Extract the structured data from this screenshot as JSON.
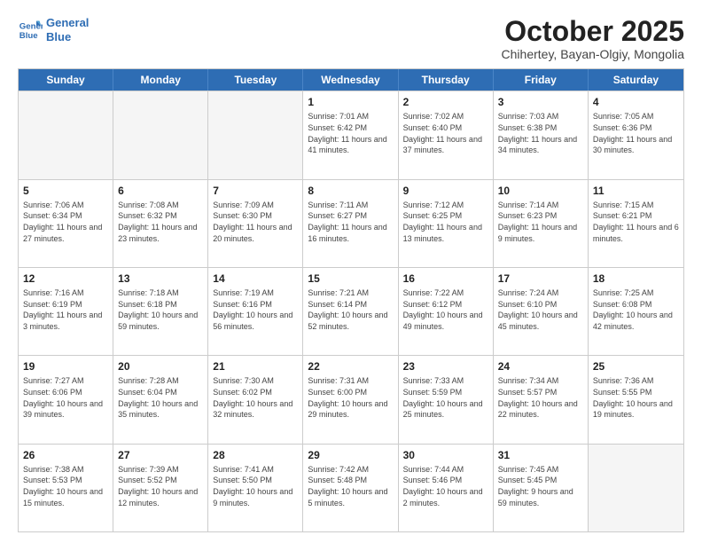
{
  "logo": {
    "line1": "General",
    "line2": "Blue"
  },
  "title": "October 2025",
  "subtitle": "Chihertey, Bayan-Olgiy, Mongolia",
  "days_of_week": [
    "Sunday",
    "Monday",
    "Tuesday",
    "Wednesday",
    "Thursday",
    "Friday",
    "Saturday"
  ],
  "weeks": [
    [
      {
        "day": "",
        "info": ""
      },
      {
        "day": "",
        "info": ""
      },
      {
        "day": "",
        "info": ""
      },
      {
        "day": "1",
        "info": "Sunrise: 7:01 AM\nSunset: 6:42 PM\nDaylight: 11 hours and 41 minutes."
      },
      {
        "day": "2",
        "info": "Sunrise: 7:02 AM\nSunset: 6:40 PM\nDaylight: 11 hours and 37 minutes."
      },
      {
        "day": "3",
        "info": "Sunrise: 7:03 AM\nSunset: 6:38 PM\nDaylight: 11 hours and 34 minutes."
      },
      {
        "day": "4",
        "info": "Sunrise: 7:05 AM\nSunset: 6:36 PM\nDaylight: 11 hours and 30 minutes."
      }
    ],
    [
      {
        "day": "5",
        "info": "Sunrise: 7:06 AM\nSunset: 6:34 PM\nDaylight: 11 hours and 27 minutes."
      },
      {
        "day": "6",
        "info": "Sunrise: 7:08 AM\nSunset: 6:32 PM\nDaylight: 11 hours and 23 minutes."
      },
      {
        "day": "7",
        "info": "Sunrise: 7:09 AM\nSunset: 6:30 PM\nDaylight: 11 hours and 20 minutes."
      },
      {
        "day": "8",
        "info": "Sunrise: 7:11 AM\nSunset: 6:27 PM\nDaylight: 11 hours and 16 minutes."
      },
      {
        "day": "9",
        "info": "Sunrise: 7:12 AM\nSunset: 6:25 PM\nDaylight: 11 hours and 13 minutes."
      },
      {
        "day": "10",
        "info": "Sunrise: 7:14 AM\nSunset: 6:23 PM\nDaylight: 11 hours and 9 minutes."
      },
      {
        "day": "11",
        "info": "Sunrise: 7:15 AM\nSunset: 6:21 PM\nDaylight: 11 hours and 6 minutes."
      }
    ],
    [
      {
        "day": "12",
        "info": "Sunrise: 7:16 AM\nSunset: 6:19 PM\nDaylight: 11 hours and 3 minutes."
      },
      {
        "day": "13",
        "info": "Sunrise: 7:18 AM\nSunset: 6:18 PM\nDaylight: 10 hours and 59 minutes."
      },
      {
        "day": "14",
        "info": "Sunrise: 7:19 AM\nSunset: 6:16 PM\nDaylight: 10 hours and 56 minutes."
      },
      {
        "day": "15",
        "info": "Sunrise: 7:21 AM\nSunset: 6:14 PM\nDaylight: 10 hours and 52 minutes."
      },
      {
        "day": "16",
        "info": "Sunrise: 7:22 AM\nSunset: 6:12 PM\nDaylight: 10 hours and 49 minutes."
      },
      {
        "day": "17",
        "info": "Sunrise: 7:24 AM\nSunset: 6:10 PM\nDaylight: 10 hours and 45 minutes."
      },
      {
        "day": "18",
        "info": "Sunrise: 7:25 AM\nSunset: 6:08 PM\nDaylight: 10 hours and 42 minutes."
      }
    ],
    [
      {
        "day": "19",
        "info": "Sunrise: 7:27 AM\nSunset: 6:06 PM\nDaylight: 10 hours and 39 minutes."
      },
      {
        "day": "20",
        "info": "Sunrise: 7:28 AM\nSunset: 6:04 PM\nDaylight: 10 hours and 35 minutes."
      },
      {
        "day": "21",
        "info": "Sunrise: 7:30 AM\nSunset: 6:02 PM\nDaylight: 10 hours and 32 minutes."
      },
      {
        "day": "22",
        "info": "Sunrise: 7:31 AM\nSunset: 6:00 PM\nDaylight: 10 hours and 29 minutes."
      },
      {
        "day": "23",
        "info": "Sunrise: 7:33 AM\nSunset: 5:59 PM\nDaylight: 10 hours and 25 minutes."
      },
      {
        "day": "24",
        "info": "Sunrise: 7:34 AM\nSunset: 5:57 PM\nDaylight: 10 hours and 22 minutes."
      },
      {
        "day": "25",
        "info": "Sunrise: 7:36 AM\nSunset: 5:55 PM\nDaylight: 10 hours and 19 minutes."
      }
    ],
    [
      {
        "day": "26",
        "info": "Sunrise: 7:38 AM\nSunset: 5:53 PM\nDaylight: 10 hours and 15 minutes."
      },
      {
        "day": "27",
        "info": "Sunrise: 7:39 AM\nSunset: 5:52 PM\nDaylight: 10 hours and 12 minutes."
      },
      {
        "day": "28",
        "info": "Sunrise: 7:41 AM\nSunset: 5:50 PM\nDaylight: 10 hours and 9 minutes."
      },
      {
        "day": "29",
        "info": "Sunrise: 7:42 AM\nSunset: 5:48 PM\nDaylight: 10 hours and 5 minutes."
      },
      {
        "day": "30",
        "info": "Sunrise: 7:44 AM\nSunset: 5:46 PM\nDaylight: 10 hours and 2 minutes."
      },
      {
        "day": "31",
        "info": "Sunrise: 7:45 AM\nSunset: 5:45 PM\nDaylight: 9 hours and 59 minutes."
      },
      {
        "day": "",
        "info": ""
      }
    ]
  ]
}
